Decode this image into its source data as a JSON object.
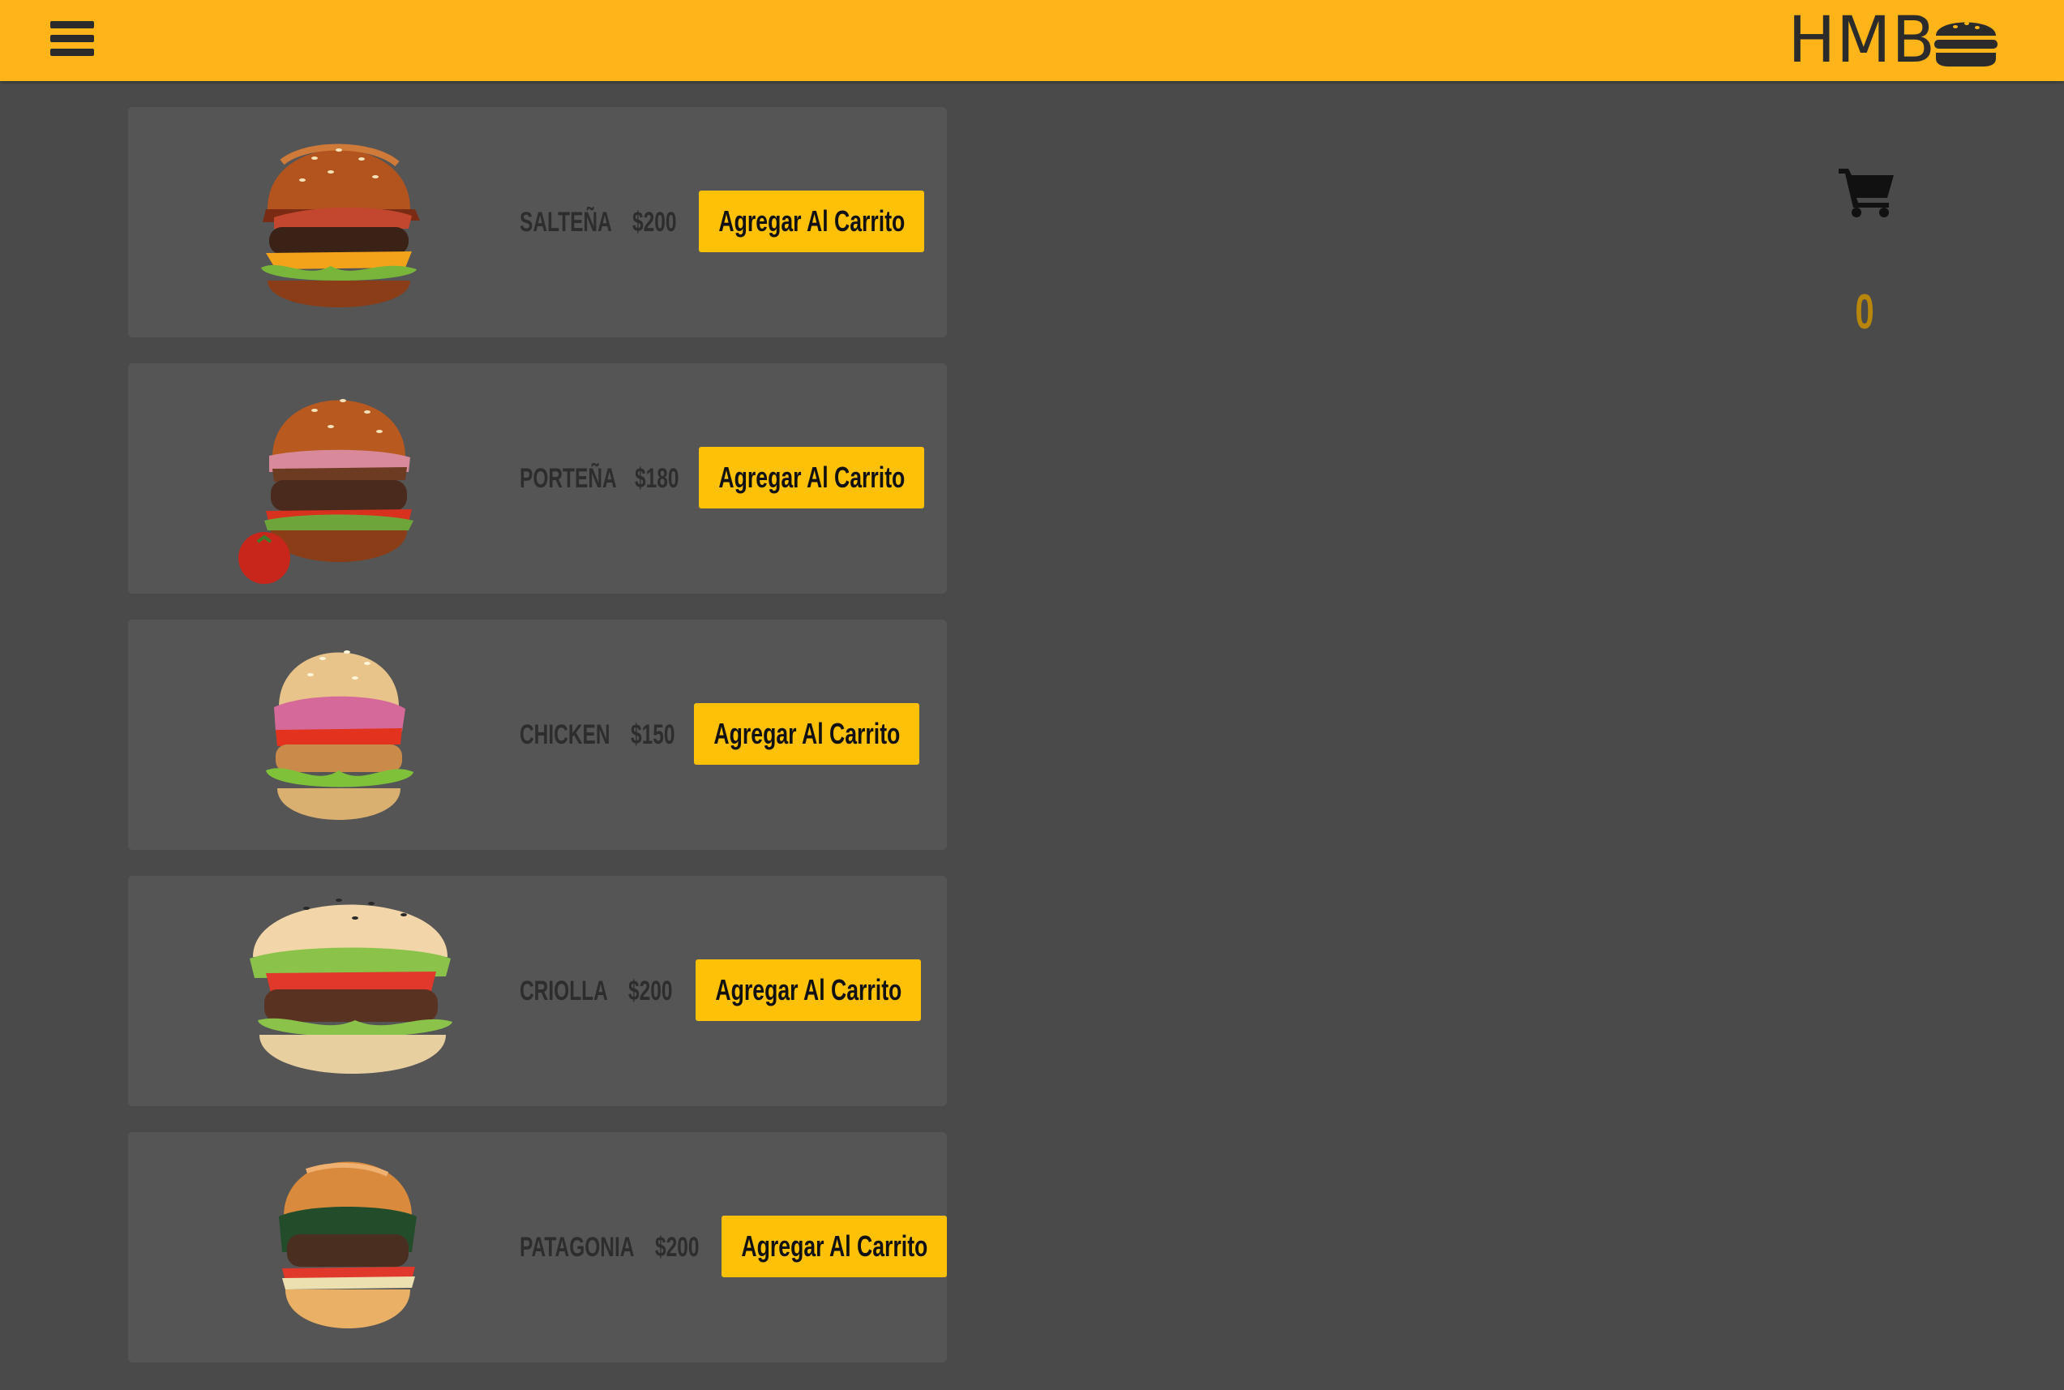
{
  "header": {
    "logo_text": "HMB",
    "colors": {
      "bar": "#ffb51a",
      "icon": "#2b2b2b"
    }
  },
  "cart": {
    "count": "0",
    "icon": "shopping-cart-icon",
    "count_color": "#b8860b"
  },
  "products": [
    {
      "name": "SALTEÑA",
      "price": "$200",
      "button_label": "Agregar Al Carrito"
    },
    {
      "name": "PORTEÑA",
      "price": "$180",
      "button_label": "Agregar Al Carrito"
    },
    {
      "name": "CHICKEN",
      "price": "$150",
      "button_label": "Agregar Al Carrito"
    },
    {
      "name": "CRIOLLA",
      "price": "$200",
      "button_label": "Agregar Al Carrito"
    },
    {
      "name": "PATAGONIA",
      "price": "$200",
      "button_label": "Agregar Al Carrito"
    }
  ],
  "colors": {
    "background": "#4a4a4a",
    "card": "#555555",
    "button": "#ffc107"
  }
}
